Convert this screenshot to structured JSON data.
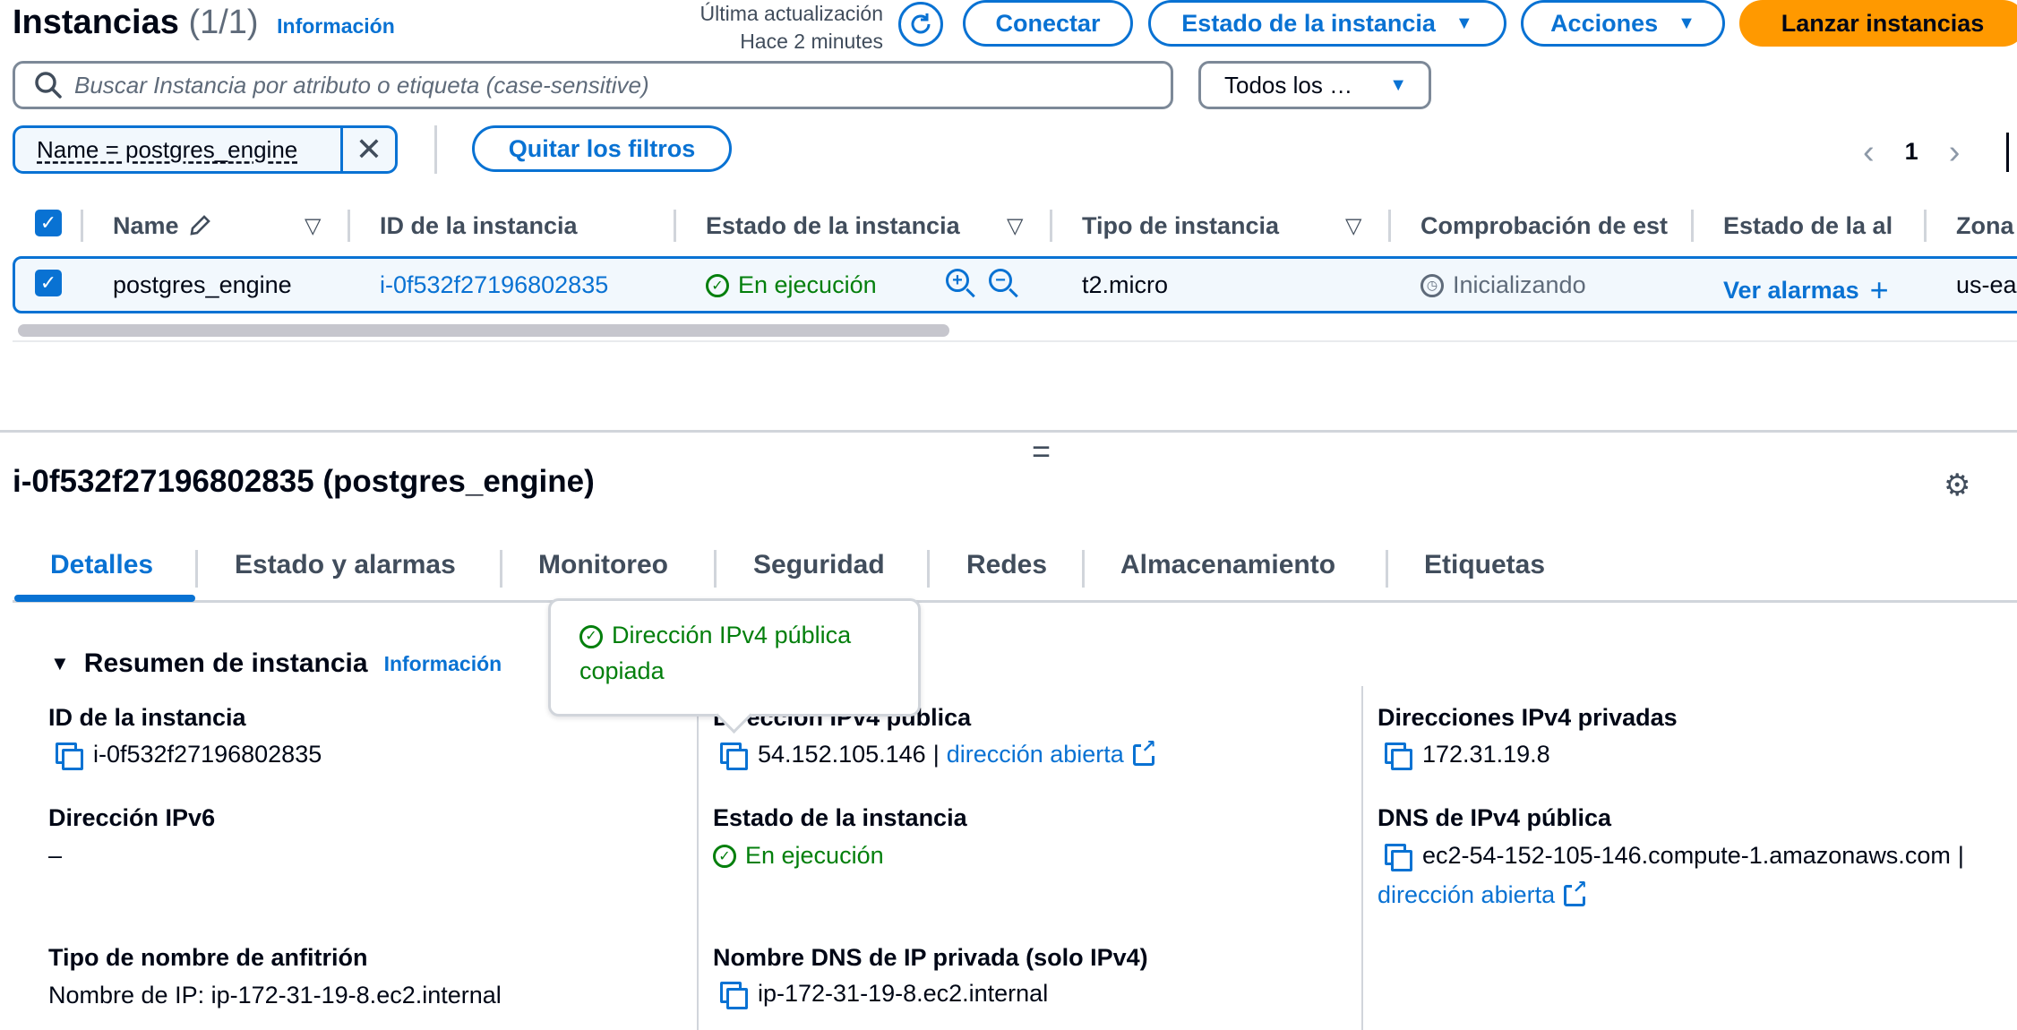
{
  "header": {
    "title": "Instancias",
    "count": "(1/1)",
    "info_link": "Información",
    "last_update_label": "Última actualización",
    "last_update_value": "Hace 2 minutes",
    "buttons": {
      "connect": "Conectar",
      "instance_state": "Estado de la instancia",
      "actions": "Acciones",
      "launch": "Lanzar instancias"
    }
  },
  "search": {
    "placeholder": "Buscar Instancia por atributo o etiqueta (case-sensitive)",
    "state_filter": "Todos los …"
  },
  "filters": {
    "token": "Name = postgres_engine",
    "clear_label": "Quitar los filtros"
  },
  "pagination": {
    "current_page": "1"
  },
  "table": {
    "columns": [
      "Name",
      "ID de la instancia",
      "Estado de la instancia",
      "Tipo de instancia",
      "Comprobación de est",
      "Estado de la al",
      "Zona"
    ],
    "rows": [
      {
        "name": "postgres_engine",
        "id": "i-0f532f27196802835",
        "state": "En ejecución",
        "type": "t2.micro",
        "status_check": "Inicializando",
        "alarm_link": "Ver alarmas",
        "zone": "us-ea"
      }
    ]
  },
  "details": {
    "title": "i-0f532f27196802835 (postgres_engine)",
    "tabs": [
      "Detalles",
      "Estado y alarmas",
      "Monitoreo",
      "Seguridad",
      "Redes",
      "Almacenamiento",
      "Etiquetas"
    ],
    "section_title": "Resumen de instancia",
    "section_info": "Información",
    "fields": {
      "instance_id_label": "ID de la instancia",
      "instance_id_value": "i-0f532f27196802835",
      "ipv6_label": "Dirección IPv6",
      "ipv6_value": "–",
      "hostname_type_label": "Tipo de nombre de anfitrión",
      "hostname_type_value": "Nombre de IP: ip-172-31-19-8.ec2.internal",
      "public_ipv4_label": "Dirección IPv4 pública",
      "public_ipv4_value": "54.152.105.146",
      "open_address": "dirección abierta",
      "instance_state_label": "Estado de la instancia",
      "instance_state_value": "En ejecución",
      "private_dns_label": "Nombre DNS de IP privada (solo IPv4)",
      "private_dns_value": "ip-172-31-19-8.ec2.internal",
      "private_ipv4_label": "Direcciones IPv4 privadas",
      "private_ipv4_value": "172.31.19.8",
      "public_dns_label": "DNS de IPv4 pública",
      "public_dns_value": "ec2-54-152-105-146.compute-1.amazonaws.com",
      "public_dns_open": "dirección abierta"
    },
    "popover": "Dirección IPv4 pública copiada"
  },
  "colors": {
    "accent": "#0972d3",
    "success": "#037f0c",
    "primary_button": "#ff9900"
  },
  "icons": [
    "refresh-icon",
    "search-icon",
    "caret-down-icon",
    "close-icon",
    "edit-icon",
    "sort-icon",
    "check-circle-icon",
    "zoom-in-icon",
    "zoom-out-icon",
    "clock-icon",
    "plus-icon",
    "copy-icon",
    "external-link-icon",
    "gear-icon",
    "chevron-left-icon",
    "chevron-right-icon",
    "drag-handle-icon"
  ]
}
